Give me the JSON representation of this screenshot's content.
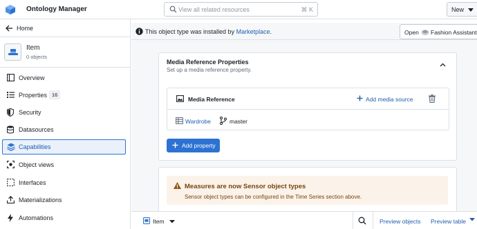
{
  "app": {
    "title": "Ontology Manager",
    "search_placeholder": "View all related resources",
    "search_shortcut": "⌘ K",
    "new_label": "New",
    "accent_color": "#2d72d2"
  },
  "sidebar": {
    "home_label": "Home",
    "object": {
      "name": "Item",
      "count": "0 objects"
    },
    "items": [
      {
        "label": "Overview",
        "icon": "overview-icon"
      },
      {
        "label": "Properties",
        "icon": "properties-icon",
        "badge": "16"
      },
      {
        "label": "Security",
        "icon": "shield-icon"
      },
      {
        "label": "Datasources",
        "icon": "database-icon"
      },
      {
        "label": "Capabilities",
        "icon": "layers-icon",
        "active": true
      },
      {
        "label": "Object views",
        "icon": "object-view-icon"
      },
      {
        "label": "Interfaces",
        "icon": "interface-icon"
      },
      {
        "label": "Materializations",
        "icon": "export-icon"
      },
      {
        "label": "Automations",
        "icon": "lightning-icon"
      }
    ]
  },
  "banner": {
    "text_before": "This object type was installed by ",
    "link": "Marketplace",
    "text_after": ".",
    "open_label": "Open",
    "open_target": "Fashion Assistant"
  },
  "media_section": {
    "title": "Media Reference Properties",
    "subtitle": "Set up a media reference property.",
    "property_name": "Media Reference",
    "add_source_label": "Add media source",
    "datasource": "Wardrobe",
    "branch": "master",
    "add_property_label": "Add property"
  },
  "warning": {
    "title": "Measures are now Sensor object types",
    "body": "Sensor object types can be configured in the Time Series section above.",
    "color": "#77450d"
  },
  "bottom_bar": {
    "object_label": "Item",
    "preview_objects": "Preview objects",
    "preview_table": "Preview table"
  }
}
